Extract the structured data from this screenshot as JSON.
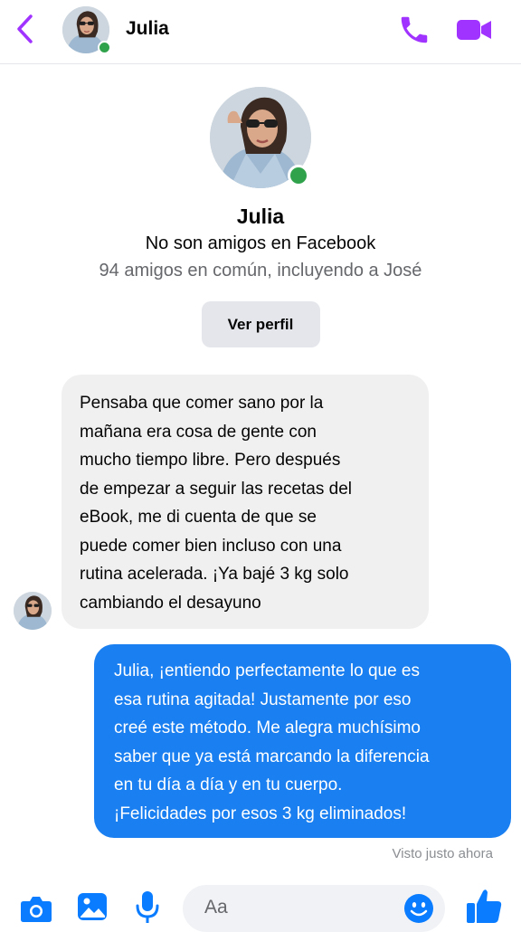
{
  "header": {
    "name": "Julia",
    "online": true,
    "accent_color": "#a033ff",
    "icons": {
      "back": "chevron-left-icon",
      "call": "phone-icon",
      "video": "video-camera-icon"
    }
  },
  "profile": {
    "name": "Julia",
    "friend_status": "No son amigos en Facebook",
    "mutual_friends": "94 amigos en común, incluyendo a José",
    "view_profile_label": "Ver perfil"
  },
  "messages": [
    {
      "direction": "incoming",
      "lines": [
        "Pensaba que comer sano por la",
        "mañana era cosa de gente con",
        "mucho tiempo libre. Pero después",
        "de empezar a seguir las recetas del",
        "eBook, me di cuenta de que se",
        "puede comer bien incluso con una",
        "rutina acelerada. ¡Ya bajé 3 kg solo",
        "cambiando el desayuno"
      ]
    },
    {
      "direction": "outgoing",
      "lines": [
        "Julia, ¡entiendo perfectamente lo que es",
        "esa rutina agitada! Justamente por eso",
        "creé este método. Me alegra muchísimo",
        "saber que ya está marcando la diferencia",
        "en tu día a día y en tu cuerpo.",
        "¡Felicidades por esos 3 kg eliminados!"
      ]
    }
  ],
  "seen_status": "Visto justo ahora",
  "composer": {
    "placeholder": "Aa",
    "accent_color": "#0a7cff",
    "icons": [
      "camera-icon",
      "image-gallery-icon",
      "microphone-icon",
      "emoji-icon",
      "thumbs-up-icon"
    ]
  }
}
